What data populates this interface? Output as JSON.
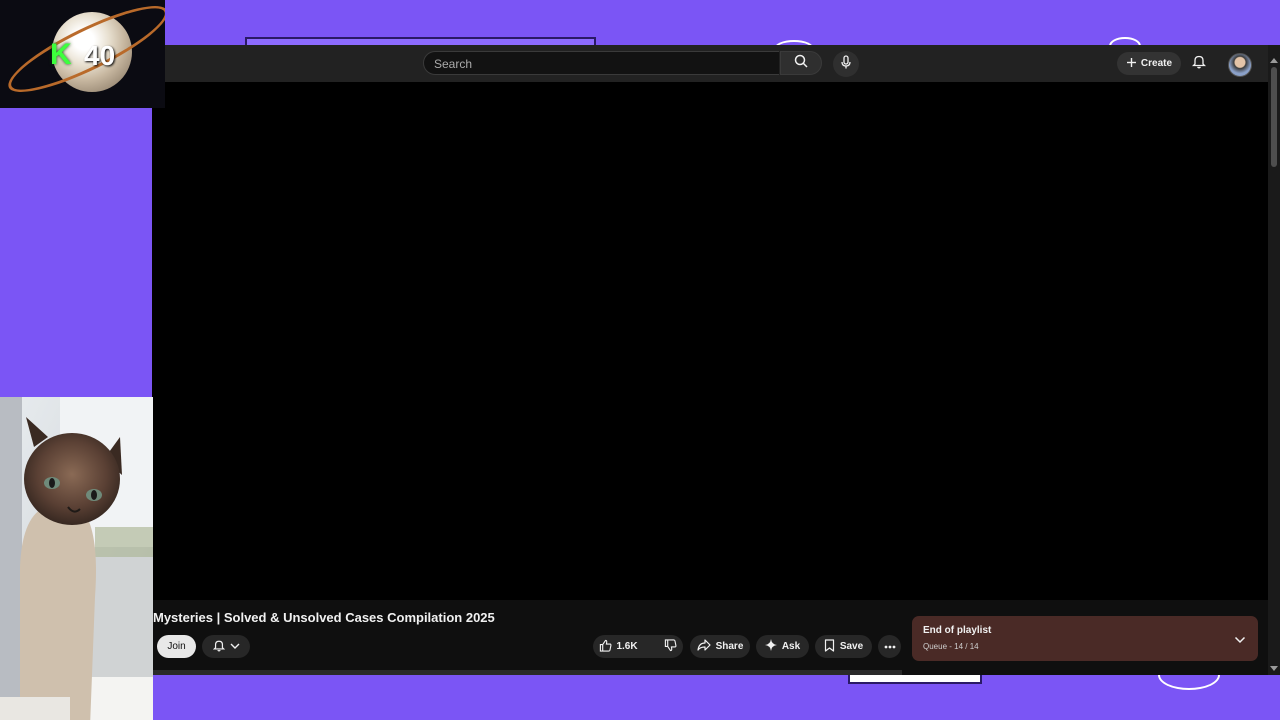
{
  "logo": {
    "letter": "K",
    "count": "40"
  },
  "header": {
    "search_placeholder": "Search",
    "create_label": "Create"
  },
  "video": {
    "title": "Mysteries | Solved & Unsolved Cases Compilation 2025"
  },
  "actions": {
    "join_label": "Join",
    "like_count": "1.6K",
    "share_label": "Share",
    "ask_label": "Ask",
    "save_label": "Save"
  },
  "playlist": {
    "title": "End of playlist",
    "queue_text": "Queue - 14 / 14"
  },
  "colors": {
    "background_purple": "#7b55f5",
    "playlist_panel": "#4a2a26",
    "logo_green": "#3dff3d"
  },
  "icons": [
    "search-icon",
    "mic-icon",
    "plus-icon",
    "bell-icon",
    "chevron-down-icon",
    "thumbs-up-icon",
    "thumbs-down-icon",
    "share-icon",
    "sparkle-icon",
    "bookmark-icon",
    "more-icon"
  ]
}
